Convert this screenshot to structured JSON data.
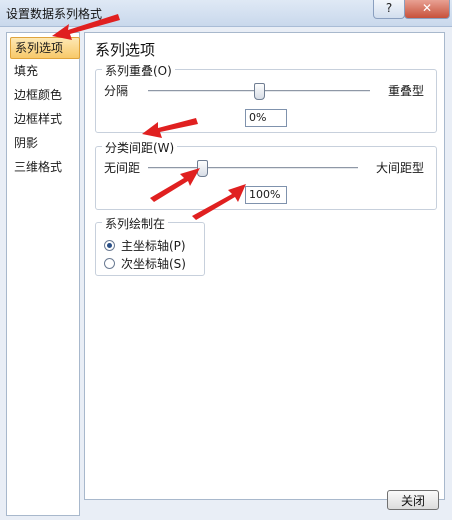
{
  "window": {
    "title": "设置数据系列格式",
    "help_label": "?",
    "close_glyph": "✕"
  },
  "sidebar": {
    "items": [
      {
        "label": "系列选项",
        "selected": true
      },
      {
        "label": "填充"
      },
      {
        "label": "边框颜色"
      },
      {
        "label": "边框样式"
      },
      {
        "label": "阴影"
      },
      {
        "label": "三维格式"
      }
    ]
  },
  "main": {
    "title": "系列选项",
    "overlap": {
      "legend": "系列重叠(O)",
      "left_label": "分隔",
      "right_label": "重叠型",
      "value": "0%"
    },
    "gap": {
      "legend": "分类间距(W)",
      "left_label": "无间距",
      "right_label": "大间距型",
      "value": "100%"
    },
    "axis": {
      "legend": "系列绘制在",
      "options": [
        {
          "label": "主坐标轴(P)",
          "checked": true
        },
        {
          "label": "次坐标轴(S)",
          "checked": false
        }
      ]
    }
  },
  "footer": {
    "close_label": "关闭"
  },
  "colors": {
    "arrow": "#e02020",
    "selected_item": "#f8c96a"
  }
}
